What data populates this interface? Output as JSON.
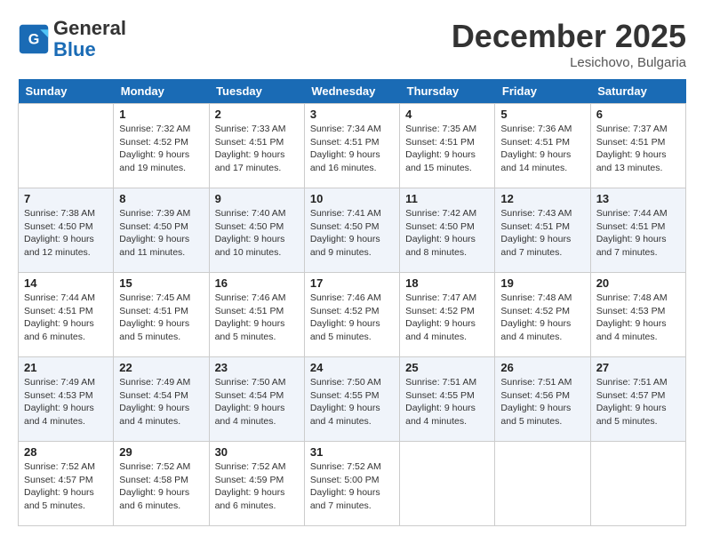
{
  "logo": {
    "line1": "General",
    "line2": "Blue"
  },
  "title": "December 2025",
  "location": "Lesichovo, Bulgaria",
  "days_of_week": [
    "Sunday",
    "Monday",
    "Tuesday",
    "Wednesday",
    "Thursday",
    "Friday",
    "Saturday"
  ],
  "weeks": [
    [
      {
        "day": "",
        "info": ""
      },
      {
        "day": "1",
        "info": "Sunrise: 7:32 AM\nSunset: 4:52 PM\nDaylight: 9 hours\nand 19 minutes."
      },
      {
        "day": "2",
        "info": "Sunrise: 7:33 AM\nSunset: 4:51 PM\nDaylight: 9 hours\nand 17 minutes."
      },
      {
        "day": "3",
        "info": "Sunrise: 7:34 AM\nSunset: 4:51 PM\nDaylight: 9 hours\nand 16 minutes."
      },
      {
        "day": "4",
        "info": "Sunrise: 7:35 AM\nSunset: 4:51 PM\nDaylight: 9 hours\nand 15 minutes."
      },
      {
        "day": "5",
        "info": "Sunrise: 7:36 AM\nSunset: 4:51 PM\nDaylight: 9 hours\nand 14 minutes."
      },
      {
        "day": "6",
        "info": "Sunrise: 7:37 AM\nSunset: 4:51 PM\nDaylight: 9 hours\nand 13 minutes."
      }
    ],
    [
      {
        "day": "7",
        "info": "Sunrise: 7:38 AM\nSunset: 4:50 PM\nDaylight: 9 hours\nand 12 minutes."
      },
      {
        "day": "8",
        "info": "Sunrise: 7:39 AM\nSunset: 4:50 PM\nDaylight: 9 hours\nand 11 minutes."
      },
      {
        "day": "9",
        "info": "Sunrise: 7:40 AM\nSunset: 4:50 PM\nDaylight: 9 hours\nand 10 minutes."
      },
      {
        "day": "10",
        "info": "Sunrise: 7:41 AM\nSunset: 4:50 PM\nDaylight: 9 hours\nand 9 minutes."
      },
      {
        "day": "11",
        "info": "Sunrise: 7:42 AM\nSunset: 4:50 PM\nDaylight: 9 hours\nand 8 minutes."
      },
      {
        "day": "12",
        "info": "Sunrise: 7:43 AM\nSunset: 4:51 PM\nDaylight: 9 hours\nand 7 minutes."
      },
      {
        "day": "13",
        "info": "Sunrise: 7:44 AM\nSunset: 4:51 PM\nDaylight: 9 hours\nand 7 minutes."
      }
    ],
    [
      {
        "day": "14",
        "info": "Sunrise: 7:44 AM\nSunset: 4:51 PM\nDaylight: 9 hours\nand 6 minutes."
      },
      {
        "day": "15",
        "info": "Sunrise: 7:45 AM\nSunset: 4:51 PM\nDaylight: 9 hours\nand 5 minutes."
      },
      {
        "day": "16",
        "info": "Sunrise: 7:46 AM\nSunset: 4:51 PM\nDaylight: 9 hours\nand 5 minutes."
      },
      {
        "day": "17",
        "info": "Sunrise: 7:46 AM\nSunset: 4:52 PM\nDaylight: 9 hours\nand 5 minutes."
      },
      {
        "day": "18",
        "info": "Sunrise: 7:47 AM\nSunset: 4:52 PM\nDaylight: 9 hours\nand 4 minutes."
      },
      {
        "day": "19",
        "info": "Sunrise: 7:48 AM\nSunset: 4:52 PM\nDaylight: 9 hours\nand 4 minutes."
      },
      {
        "day": "20",
        "info": "Sunrise: 7:48 AM\nSunset: 4:53 PM\nDaylight: 9 hours\nand 4 minutes."
      }
    ],
    [
      {
        "day": "21",
        "info": "Sunrise: 7:49 AM\nSunset: 4:53 PM\nDaylight: 9 hours\nand 4 minutes."
      },
      {
        "day": "22",
        "info": "Sunrise: 7:49 AM\nSunset: 4:54 PM\nDaylight: 9 hours\nand 4 minutes."
      },
      {
        "day": "23",
        "info": "Sunrise: 7:50 AM\nSunset: 4:54 PM\nDaylight: 9 hours\nand 4 minutes."
      },
      {
        "day": "24",
        "info": "Sunrise: 7:50 AM\nSunset: 4:55 PM\nDaylight: 9 hours\nand 4 minutes."
      },
      {
        "day": "25",
        "info": "Sunrise: 7:51 AM\nSunset: 4:55 PM\nDaylight: 9 hours\nand 4 minutes."
      },
      {
        "day": "26",
        "info": "Sunrise: 7:51 AM\nSunset: 4:56 PM\nDaylight: 9 hours\nand 5 minutes."
      },
      {
        "day": "27",
        "info": "Sunrise: 7:51 AM\nSunset: 4:57 PM\nDaylight: 9 hours\nand 5 minutes."
      }
    ],
    [
      {
        "day": "28",
        "info": "Sunrise: 7:52 AM\nSunset: 4:57 PM\nDaylight: 9 hours\nand 5 minutes."
      },
      {
        "day": "29",
        "info": "Sunrise: 7:52 AM\nSunset: 4:58 PM\nDaylight: 9 hours\nand 6 minutes."
      },
      {
        "day": "30",
        "info": "Sunrise: 7:52 AM\nSunset: 4:59 PM\nDaylight: 9 hours\nand 6 minutes."
      },
      {
        "day": "31",
        "info": "Sunrise: 7:52 AM\nSunset: 5:00 PM\nDaylight: 9 hours\nand 7 minutes."
      },
      {
        "day": "",
        "info": ""
      },
      {
        "day": "",
        "info": ""
      },
      {
        "day": "",
        "info": ""
      }
    ]
  ]
}
